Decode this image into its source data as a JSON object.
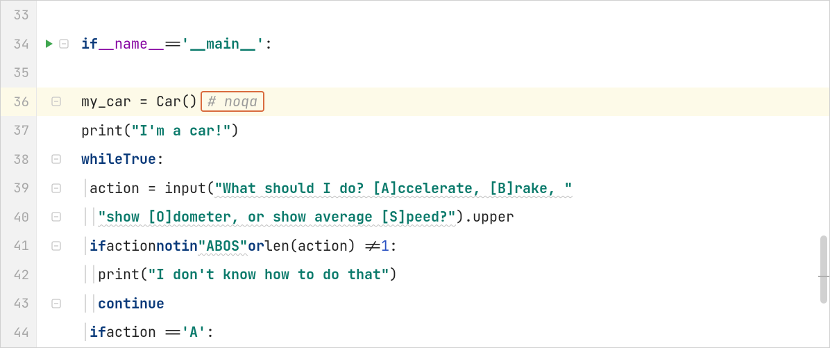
{
  "gutter": {
    "lines": [
      "33",
      "34",
      "35",
      "36",
      "37",
      "38",
      "39",
      "40",
      "41",
      "42",
      "43",
      "44"
    ]
  },
  "icons": {
    "run_line": 34,
    "fold_minus_lines": [
      34,
      36,
      38,
      39,
      40,
      41,
      43
    ],
    "highlighted_line": 36
  },
  "code": {
    "l34": {
      "kw_if": "if",
      "dunder": "__name__",
      "eq": "==",
      "str": "'__main__'",
      "colon": ":"
    },
    "l36": {
      "ident": "my_car = Car()",
      "noqa": "# noqa"
    },
    "l37": {
      "fn": "print(",
      "str": "\"I'm a car!\"",
      "close": ")"
    },
    "l38": {
      "kw_while": "while",
      "kw_true": "True",
      "colon": ":"
    },
    "l39": {
      "ident": "action = input(",
      "str": "\"What should I do? [A]ccelerate, [B]rake, \""
    },
    "l40": {
      "str": "\"show [O]dometer, or show average [S]peed?\"",
      "tail": ").upper"
    },
    "l41": {
      "kw_if": "if",
      "id1": "action",
      "kw_not": "not",
      "kw_in": "in",
      "str": "\"ABOS\"",
      "kw_or": "or",
      "len": "len(action) !=",
      "one": "1",
      "colon": ":"
    },
    "l42": {
      "fn": "print(",
      "str": "\"I don't know how to do that\"",
      "close": ")"
    },
    "l43": {
      "kw": "continue"
    },
    "l44": {
      "kw_if": "if",
      "id": "action ==",
      "str": "'A'",
      "colon": ":"
    }
  }
}
